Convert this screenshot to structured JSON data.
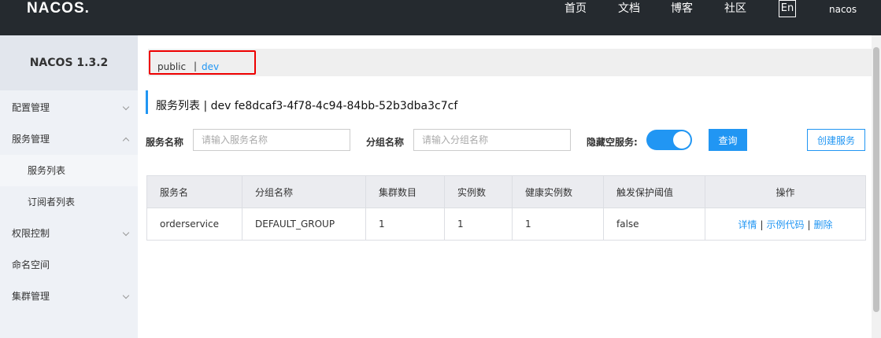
{
  "header": {
    "logo": "NACOS.",
    "nav": [
      "首页",
      "文档",
      "博客",
      "社区"
    ],
    "lang": "En",
    "user": "nacos"
  },
  "sidebar": {
    "version": "NACOS 1.3.2",
    "items": [
      {
        "label": "配置管理",
        "chevron": "down"
      },
      {
        "label": "服务管理",
        "chevron": "up"
      },
      {
        "label": "服务列表",
        "sub": true,
        "active": true
      },
      {
        "label": "订阅者列表",
        "sub": true
      },
      {
        "label": "权限控制",
        "chevron": "down"
      },
      {
        "label": "命名空间"
      },
      {
        "label": "集群管理",
        "chevron": "down"
      }
    ]
  },
  "namespace": {
    "public": "public",
    "separator": "|",
    "dev": "dev",
    "highlight_color": "#e00000"
  },
  "page": {
    "title": "服务列表  |  dev  fe8dcaf3-4f78-4c94-84bb-52b3dba3c7cf"
  },
  "filters": {
    "service_label": "服务名称",
    "service_placeholder": "请输入服务名称",
    "group_label": "分组名称",
    "group_placeholder": "请输入分组名称",
    "hide_empty_label": "隐藏空服务:",
    "hide_empty_on": true,
    "query_button": "查询",
    "create_button": "创建服务"
  },
  "table": {
    "headers": [
      "服务名",
      "分组名称",
      "集群数目",
      "实例数",
      "健康实例数",
      "触发保护阈值",
      "操作"
    ],
    "rows": [
      {
        "cells": [
          "orderservice",
          "DEFAULT_GROUP",
          "1",
          "1",
          "1",
          "false"
        ],
        "ops": [
          "详情",
          "示例代码",
          "删除"
        ]
      }
    ]
  },
  "colors": {
    "accent": "#2196f3",
    "header_bg": "#252a2f",
    "sidebar_bg": "#eef1f6"
  }
}
